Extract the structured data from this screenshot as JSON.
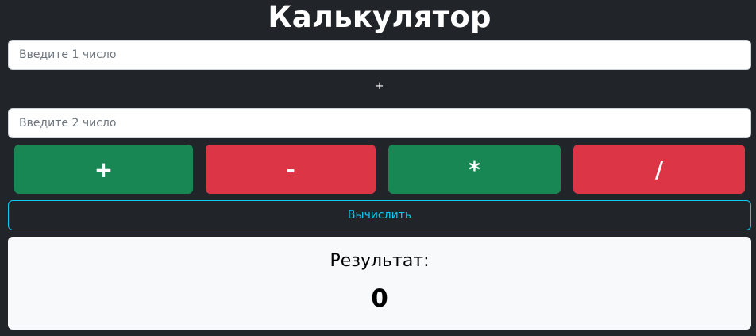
{
  "title": "Калькулятор",
  "inputs": {
    "first": {
      "value": "",
      "placeholder": "Введите 1 число"
    },
    "second": {
      "value": "",
      "placeholder": "Введите 2 число"
    }
  },
  "selected_operator": "+",
  "operators": [
    {
      "label": "+",
      "color": "#198754"
    },
    {
      "label": "-",
      "color": "#dc3545"
    },
    {
      "label": "*",
      "color": "#198754"
    },
    {
      "label": "/",
      "color": "#dc3545"
    }
  ],
  "calculate_label": "Вычислить",
  "result": {
    "label": "Результат:",
    "value": "0"
  },
  "colors": {
    "background": "#212529",
    "green": "#198754",
    "red": "#dc3545",
    "info": "#0dcaf0",
    "card": "#f8f9fa"
  }
}
